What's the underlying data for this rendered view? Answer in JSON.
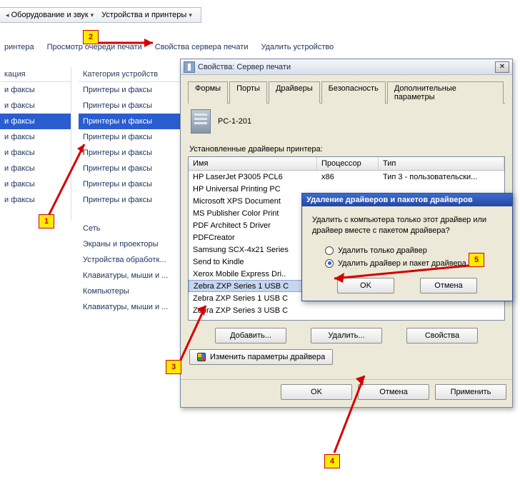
{
  "breadcrumb": {
    "seg1": "Оборудование и звук",
    "seg2": "Устройства и принтеры"
  },
  "toolbar": {
    "a": "ринтера",
    "b": "Просмотр очереди печати",
    "c": "Свойства сервера печати",
    "d": "Удалить устройство"
  },
  "columns": {
    "head_a": "кация",
    "head_b": "Категория устройств",
    "fax_a": "и факсы",
    "fax_b": "Принтеры и факсы",
    "other": [
      "Сеть",
      "Экраны и проекторы",
      "Устройства обработк...",
      "Клавиатуры, мыши и ...",
      "Компьютеры",
      "Клавиатуры, мыши и ..."
    ]
  },
  "dialog": {
    "title": "Свойства: Сервер печати",
    "tabs": [
      "Формы",
      "Порты",
      "Драйверы",
      "Безопасность",
      "Дополнительные параметры"
    ],
    "active_tab": 2,
    "server": "PC-1-201",
    "list_label": "Установленные драйверы принтера:",
    "head": {
      "name": "Имя",
      "proc": "Процессор",
      "type": "Тип"
    },
    "drivers": [
      {
        "name": "HP LaserJet P3005 PCL6",
        "proc": "x86",
        "type": "Тип 3 - пользовательски..."
      },
      {
        "name": "HP Universal Printing PC",
        "proc": "",
        "type": ""
      },
      {
        "name": "Microsoft XPS Document",
        "proc": "",
        "type": ""
      },
      {
        "name": "MS Publisher Color Print",
        "proc": "",
        "type": ""
      },
      {
        "name": "PDF Architect 5 Driver",
        "proc": "",
        "type": ""
      },
      {
        "name": "PDFCreator",
        "proc": "",
        "type": ""
      },
      {
        "name": "Samsung SCX-4x21 Series",
        "proc": "",
        "type": ""
      },
      {
        "name": "Send to Kindle",
        "proc": "",
        "type": ""
      },
      {
        "name": "Xerox Mobile Express Dri..",
        "proc": "",
        "type": ""
      },
      {
        "name": "Zebra ZXP Series 1 USB C",
        "proc": "",
        "type": ""
      },
      {
        "name": "Zebra ZXP Series 1 USB C",
        "proc": "",
        "type": ""
      },
      {
        "name": "Zebra ZXP Series 3 USB C",
        "proc": "",
        "type": ""
      }
    ],
    "selected_driver": 9,
    "btn_add": "Добавить...",
    "btn_del": "Удалить...",
    "btn_prop": "Свойства",
    "btn_change": "Изменить параметры драйвера",
    "ok": "OK",
    "cancel": "Отмена",
    "apply": "Применить"
  },
  "modal": {
    "title": "Удаление драйверов и пакетов драйверов",
    "question": "Удалить с компьютера только этот драйвер или драйвер вместе с пакетом драйвера?",
    "opt1": "Удалить только драйвер",
    "opt2": "Удалить драйвер и пакет драйвера",
    "selected": 2,
    "ok": "OK",
    "cancel": "Отмена"
  },
  "callouts": {
    "n1": "1",
    "n2": "2",
    "n3": "3",
    "n4": "4",
    "n5": "5"
  }
}
